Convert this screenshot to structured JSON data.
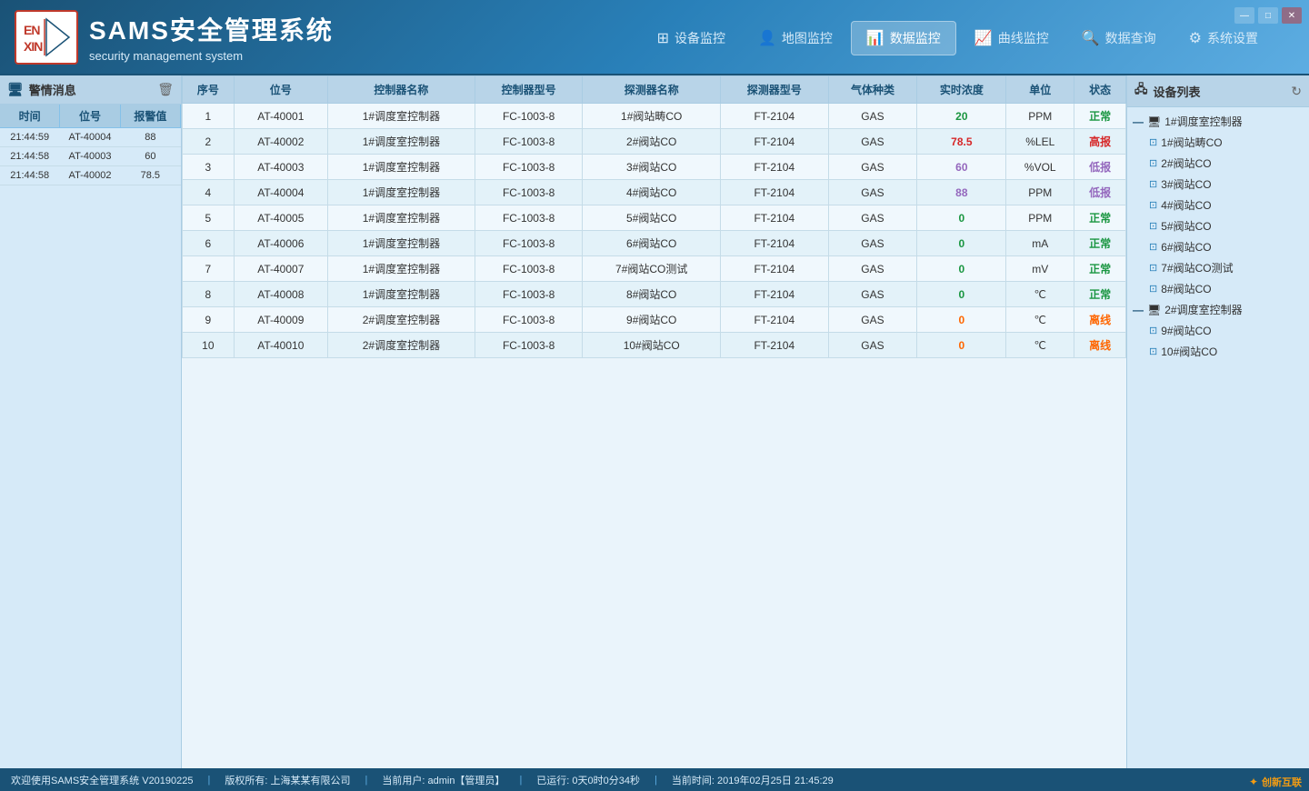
{
  "app": {
    "title": "SAMS安全管理系统",
    "subtitle": "security management system",
    "logo_text": "ENXIN"
  },
  "nav": {
    "items": [
      {
        "id": "device-monitor",
        "label": "设备监控",
        "icon": "⊞",
        "active": false
      },
      {
        "id": "map-monitor",
        "label": "地图监控",
        "icon": "👤",
        "active": false
      },
      {
        "id": "data-monitor",
        "label": "数据监控",
        "icon": "📊",
        "active": true
      },
      {
        "id": "curve-monitor",
        "label": "曲线监控",
        "icon": "📈",
        "active": false
      },
      {
        "id": "data-query",
        "label": "数据查询",
        "icon": "🔍",
        "active": false
      },
      {
        "id": "system-settings",
        "label": "系统设置",
        "icon": "⚙",
        "active": false
      }
    ]
  },
  "alarm_panel": {
    "title": "警情消息",
    "headers": [
      "时间",
      "位号",
      "报警值"
    ],
    "rows": [
      {
        "time": "21:44:59",
        "position": "AT-40004",
        "value": "88"
      },
      {
        "time": "21:44:58",
        "position": "AT-40003",
        "value": "60"
      },
      {
        "time": "21:44:58",
        "position": "AT-40002",
        "value": "78.5"
      }
    ]
  },
  "data_table": {
    "headers": [
      "序号",
      "位号",
      "控制器名称",
      "控制器型号",
      "探测器名称",
      "探测器型号",
      "气体种类",
      "实时浓度",
      "单位",
      "状态"
    ],
    "rows": [
      {
        "seq": 1,
        "position": "AT-40001",
        "ctrl_name": "1#调度室控制器",
        "ctrl_model": "FC-1003-8",
        "sensor_name": "1#阀站畴CO",
        "sensor_model": "FT-2104",
        "gas": "GAS",
        "concentration": "20",
        "unit": "PPM",
        "status": "正常",
        "status_class": "status-normal",
        "val_class": "val-normal"
      },
      {
        "seq": 2,
        "position": "AT-40002",
        "ctrl_name": "1#调度室控制器",
        "ctrl_model": "FC-1003-8",
        "sensor_name": "2#阀站CO",
        "sensor_model": "FT-2104",
        "gas": "GAS",
        "concentration": "78.5",
        "unit": "%LEL",
        "status": "高报",
        "status_class": "status-high",
        "val_class": "val-high"
      },
      {
        "seq": 3,
        "position": "AT-40003",
        "ctrl_name": "1#调度室控制器",
        "ctrl_model": "FC-1003-8",
        "sensor_name": "3#阀站CO",
        "sensor_model": "FT-2104",
        "gas": "GAS",
        "concentration": "60",
        "unit": "%VOL",
        "status": "低报",
        "status_class": "status-low",
        "val_class": "val-low"
      },
      {
        "seq": 4,
        "position": "AT-40004",
        "ctrl_name": "1#调度室控制器",
        "ctrl_model": "FC-1003-8",
        "sensor_name": "4#阀站CO",
        "sensor_model": "FT-2104",
        "gas": "GAS",
        "concentration": "88",
        "unit": "PPM",
        "status": "低报",
        "status_class": "status-low",
        "val_class": "val-low"
      },
      {
        "seq": 5,
        "position": "AT-40005",
        "ctrl_name": "1#调度室控制器",
        "ctrl_model": "FC-1003-8",
        "sensor_name": "5#阀站CO",
        "sensor_model": "FT-2104",
        "gas": "GAS",
        "concentration": "0",
        "unit": "PPM",
        "status": "正常",
        "status_class": "status-normal",
        "val_class": "val-normal"
      },
      {
        "seq": 6,
        "position": "AT-40006",
        "ctrl_name": "1#调度室控制器",
        "ctrl_model": "FC-1003-8",
        "sensor_name": "6#阀站CO",
        "sensor_model": "FT-2104",
        "gas": "GAS",
        "concentration": "0",
        "unit": "mA",
        "status": "正常",
        "status_class": "status-normal",
        "val_class": "val-normal"
      },
      {
        "seq": 7,
        "position": "AT-40007",
        "ctrl_name": "1#调度室控制器",
        "ctrl_model": "FC-1003-8",
        "sensor_name": "7#阀站CO测试",
        "sensor_model": "FT-2104",
        "gas": "GAS",
        "concentration": "0",
        "unit": "mV",
        "status": "正常",
        "status_class": "status-normal",
        "val_class": "val-normal"
      },
      {
        "seq": 8,
        "position": "AT-40008",
        "ctrl_name": "1#调度室控制器",
        "ctrl_model": "FC-1003-8",
        "sensor_name": "8#阀站CO",
        "sensor_model": "FT-2104",
        "gas": "GAS",
        "concentration": "0",
        "unit": "℃",
        "status": "正常",
        "status_class": "status-normal",
        "val_class": "val-normal"
      },
      {
        "seq": 9,
        "position": "AT-40009",
        "ctrl_name": "2#调度室控制器",
        "ctrl_model": "FC-1003-8",
        "sensor_name": "9#阀站CO",
        "sensor_model": "FT-2104",
        "gas": "GAS",
        "concentration": "0",
        "unit": "℃",
        "status": "离线",
        "status_class": "status-offline",
        "val_class": "val-offline"
      },
      {
        "seq": 10,
        "position": "AT-40010",
        "ctrl_name": "2#调度室控制器",
        "ctrl_model": "FC-1003-8",
        "sensor_name": "10#阀站CO",
        "sensor_model": "FT-2104",
        "gas": "GAS",
        "concentration": "0",
        "unit": "℃",
        "status": "离线",
        "status_class": "status-offline",
        "val_class": "val-offline"
      }
    ]
  },
  "device_panel": {
    "title": "设备列表",
    "groups": [
      {
        "name": "1#调度室控制器",
        "items": [
          "1#阀站畴CO",
          "2#阀站CO",
          "3#阀站CO",
          "4#阀站CO",
          "5#阀站CO",
          "6#阀站CO",
          "7#阀站CO测试",
          "8#阀站CO"
        ]
      },
      {
        "name": "2#调度室控制器",
        "items": [
          "9#阀站CO",
          "10#阀站CO"
        ]
      }
    ]
  },
  "status_bar": {
    "welcome": "欢迎使用SAMS安全管理系统 V20190225",
    "copyright": "版权所有: 上海某某有限公司",
    "user": "当前用户: admin【管理员】",
    "runtime": "已运行: 0天0时0分34秒",
    "datetime": "当前时间: 2019年02月25日 21:45:29",
    "brand": "创新互联"
  },
  "window_controls": {
    "minimize": "—",
    "maximize": "□",
    "close": "✕"
  }
}
